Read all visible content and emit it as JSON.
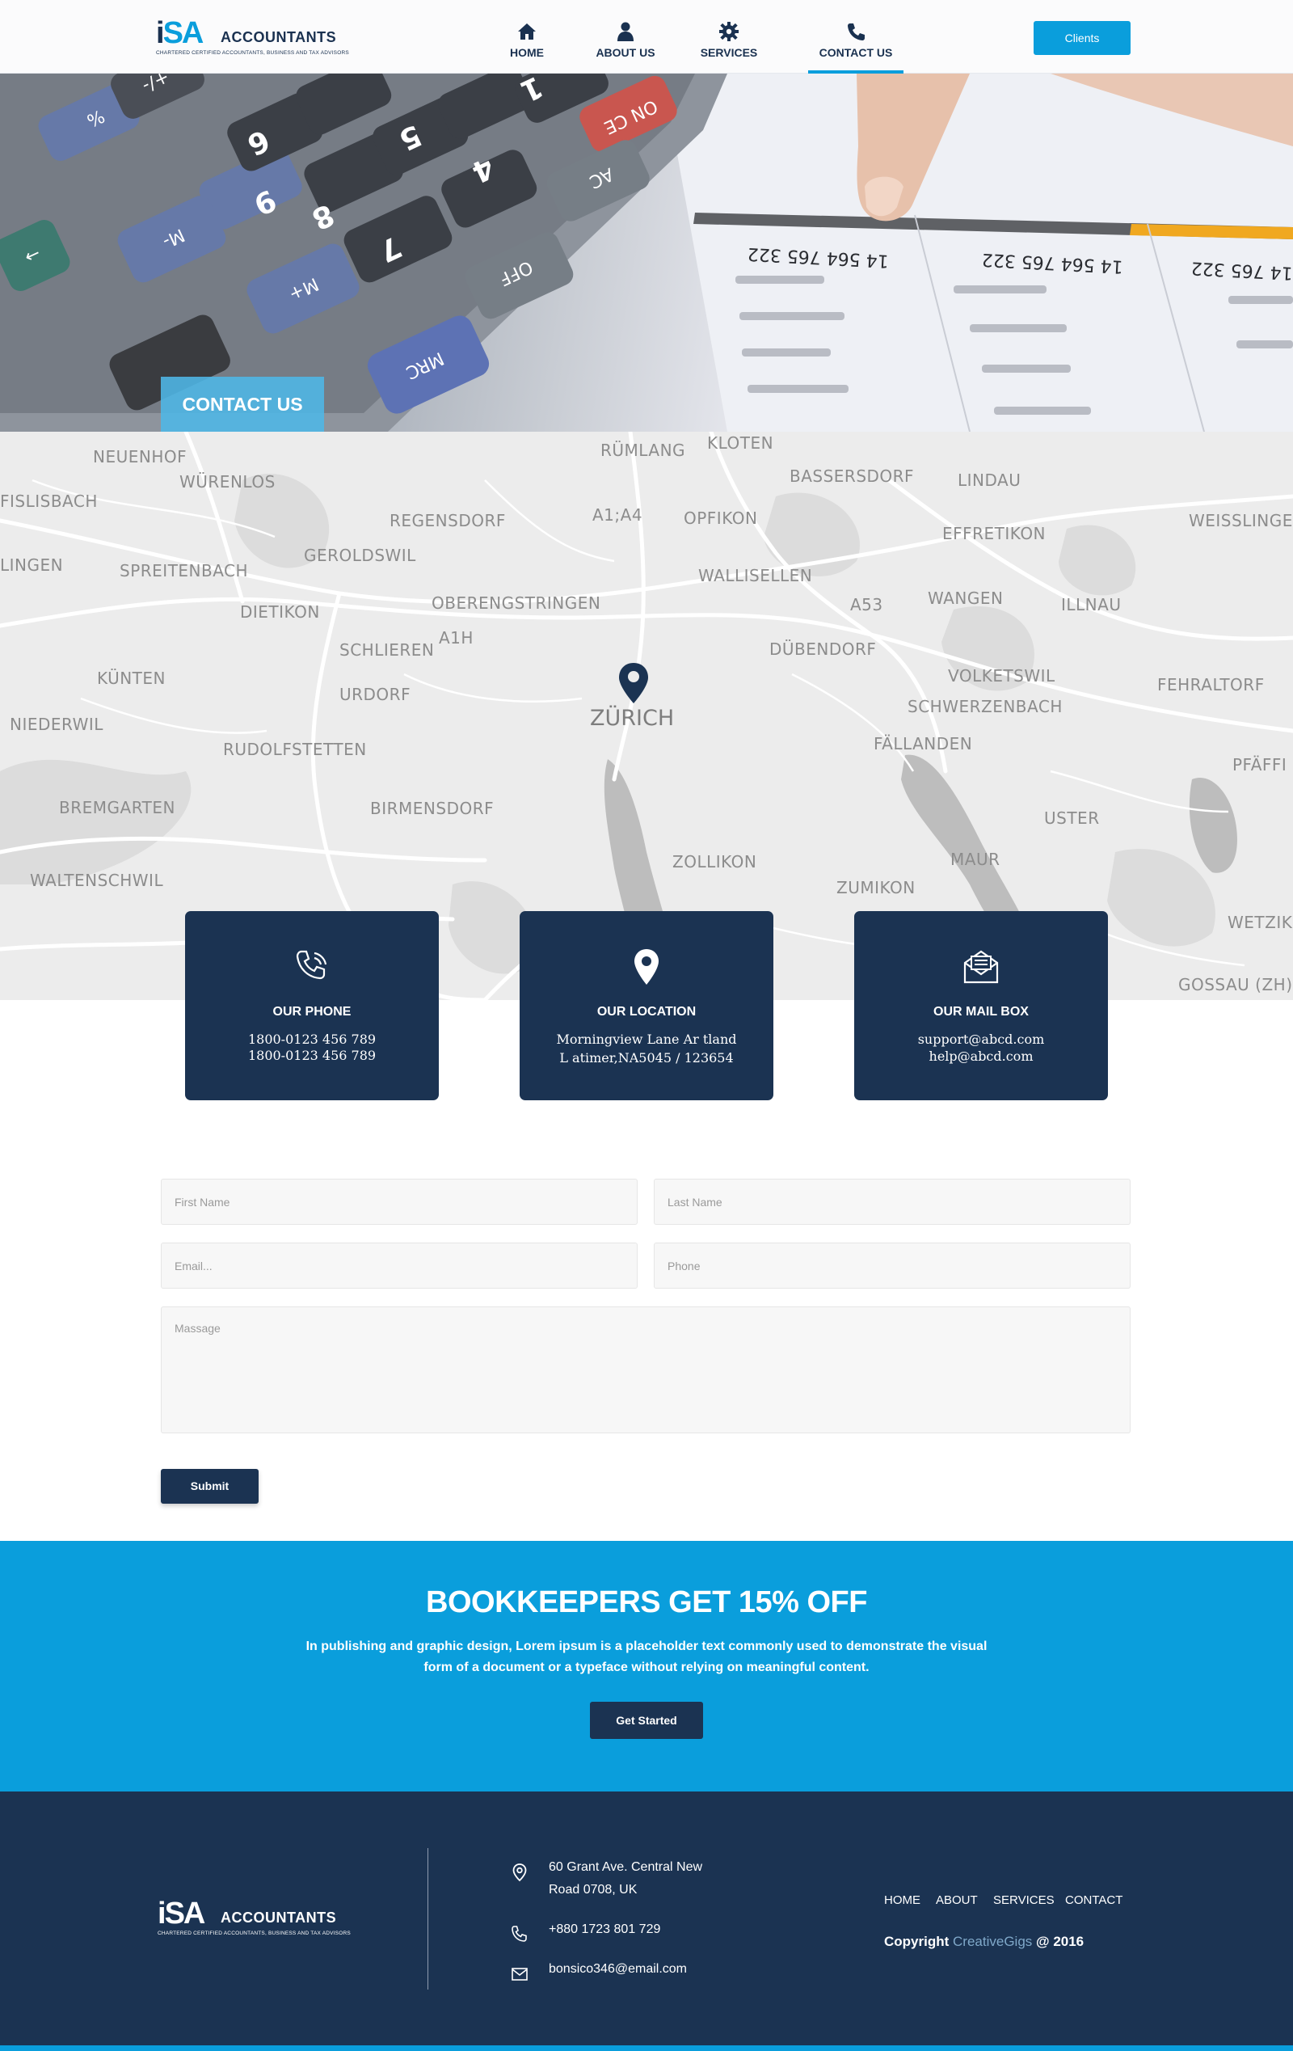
{
  "brand": {
    "mark_i": "i",
    "mark_sa": "SA",
    "word": "ACCOUNTANTS",
    "tagline": "CHARTERED CERTIFIED ACCOUNTANTS, BUSINESS AND TAX ADVISORS"
  },
  "nav": {
    "items": [
      {
        "label": "HOME",
        "icon": "home-icon"
      },
      {
        "label": "ABOUT US",
        "icon": "user-icon"
      },
      {
        "label": "SERVICES",
        "icon": "cog-icon"
      },
      {
        "label": "CONTACT US",
        "icon": "phone-icon",
        "active": true
      }
    ],
    "clients_label": "Clients"
  },
  "hero": {
    "title": "CONTACT US",
    "calculator_keys": [
      "9",
      "8",
      "7",
      "6",
      "5",
      "4",
      "1",
      "ON CE",
      "AC",
      "OFF",
      "M+",
      "M-",
      "MRC",
      "%",
      "+/-",
      "→"
    ],
    "sheet_numbers": [
      "14 564 765 322",
      "14 564 765 322",
      "14 765 322"
    ]
  },
  "map": {
    "city": "ZÜRICH",
    "labels": [
      "NEUENHOF",
      "WÜRENLOS",
      "RÜMLANG",
      "KLOTEN",
      "BASSERSDORF",
      "LINDAU",
      "FISLISBACH",
      "REGENSDORF",
      "A1;A4",
      "OPFIKON",
      "EFFRETIKON",
      "WEISSLINGEN",
      "LINGEN",
      "SPREITENBACH",
      "GEROLDSWIL",
      "WALLISELLEN",
      "A53",
      "WANGEN",
      "ILLNAU",
      "DIETIKON",
      "OBERENGSTRINGEN",
      "A1H",
      "SCHLIEREN",
      "DÜBENDORF",
      "KÜNTEN",
      "URDORF",
      "VOLKETSWIL",
      "FEHRALTORF",
      "SCHWERZENBACH",
      "NIEDERWIL",
      "RUDOLFSTETTEN",
      "FÄLLANDEN",
      "PFÄFFI",
      "BREMGARTEN",
      "BIRMENSDORF",
      "USTER",
      "ZOLLIKON",
      "MAUR",
      "WALTENSCHWIL",
      "ZUMIKON",
      "WETZIK",
      "GOSSAU (ZH)"
    ]
  },
  "cards": [
    {
      "title": "OUR PHONE",
      "icon": "phone-icon",
      "lines": [
        "1800-0123 456 789",
        "1800-0123 456 789"
      ]
    },
    {
      "title": "OUR LOCATION",
      "icon": "map-pin-icon",
      "lines": [
        "Morningview Lane Ar tland",
        "L atimer,NA5045 / 123654"
      ]
    },
    {
      "title": "OUR MAIL BOX",
      "icon": "mail-icon",
      "lines": [
        "support@abcd.com",
        "help@abcd.com"
      ]
    }
  ],
  "form": {
    "first_name_placeholder": "First Name",
    "last_name_placeholder": "Last Name",
    "email_placeholder": "Email...",
    "phone_placeholder": "Phone",
    "message_placeholder": "Massage",
    "submit_label": "Submit"
  },
  "promo": {
    "title": "BOOKKEEPERS GET 15% OFF",
    "text": "In publishing and graphic design, Lorem ipsum is a placeholder text commonly used to demonstrate the visual form of a document or a typeface without relying on meaningful content.",
    "button_label": "Get Started"
  },
  "footer": {
    "address_line1": "60 Grant Ave. Central New",
    "address_line2": "Road 0708, UK",
    "phone": "+880 1723 801 729",
    "email": "bonsico346@email.com",
    "nav": [
      "HOME",
      "ABOUT",
      "SERVICES",
      "CONTACT"
    ],
    "copyright_prefix": "Copyright",
    "copyright_brand": "CreativeGigs",
    "copyright_suffix": "@ 2016"
  },
  "colors": {
    "navy": "#1b3352",
    "accent": "#0a9edc",
    "hero_badge": "#4fb7e7"
  }
}
